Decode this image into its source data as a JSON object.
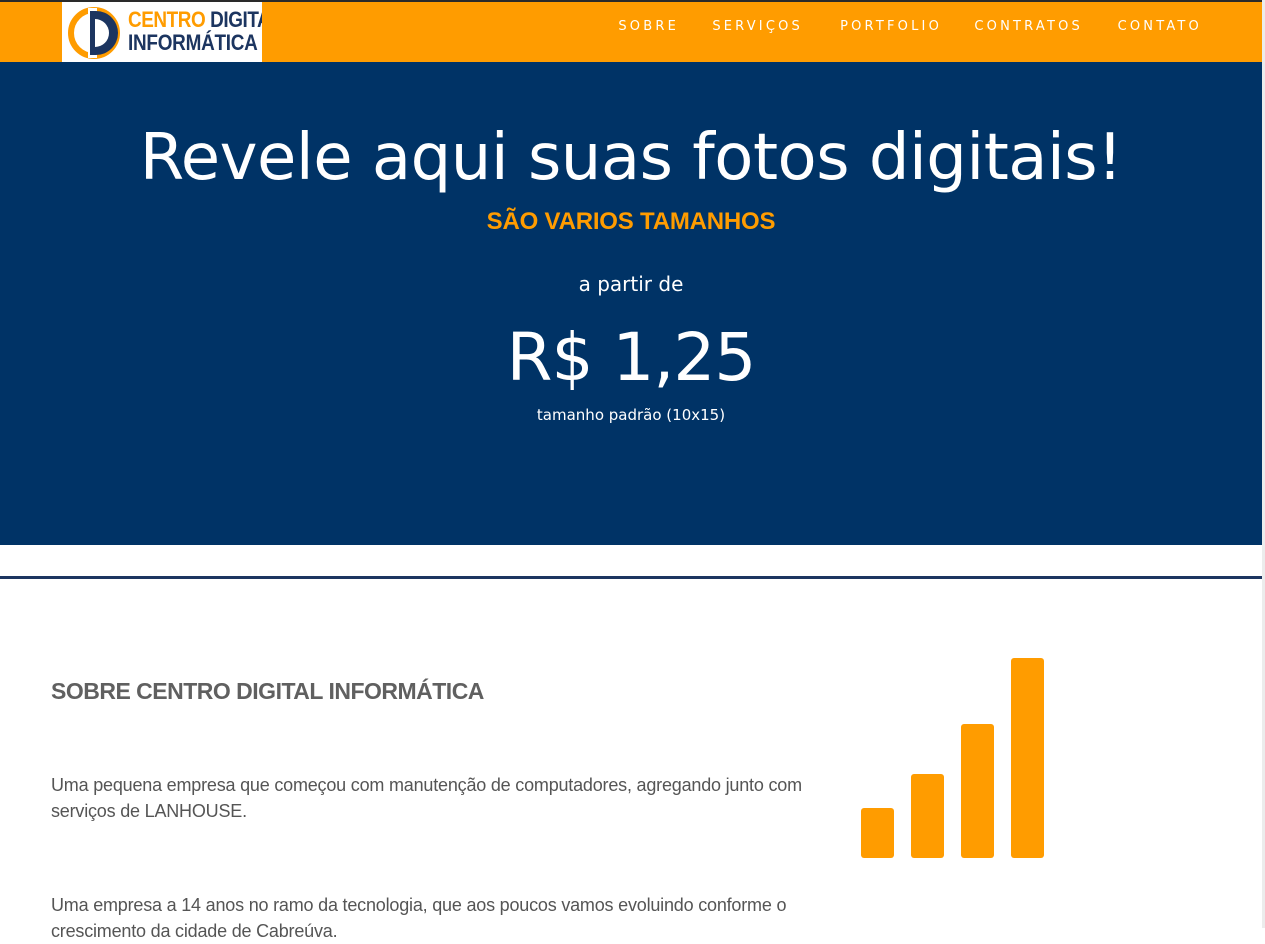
{
  "header": {
    "logo": {
      "word1": "CENTRO",
      "word2": "DIGITAL",
      "line2": "INFORMÁTICA",
      "icon": "cd-logo-icon",
      "colors": {
        "orange": "#ff9c00",
        "navy": "#1c3560"
      }
    },
    "nav": [
      {
        "label": "SOBRE"
      },
      {
        "label": "SERVIÇOS"
      },
      {
        "label": "PORTFOLIO"
      },
      {
        "label": "CONTRATOS"
      },
      {
        "label": "CONTATO"
      }
    ],
    "background": "#ff9c00"
  },
  "hero": {
    "title": "Revele aqui suas fotos digitais!",
    "subtitle": "SÃO VARIOS TAMANHOS",
    "from_label": "a partir de",
    "price": "R$ 1,25",
    "size_note": "tamanho padrão (10x15)",
    "background": "#003366",
    "accent": "#ff9c00"
  },
  "about": {
    "heading": "SOBRE CENTRO DIGITAL INFORMÁTICA",
    "paragraphs": [
      "Uma pequena empresa que começou com manutenção de computadores, agregando junto com serviços de LANHOUSE.",
      "Uma empresa a 14 anos no ramo da tecnologia, que aos poucos vamos evoluindo conforme o crescimento da cidade de Cabreúva."
    ],
    "graphic": {
      "icon": "growth-bars-icon",
      "color": "#ff9c00",
      "bar_levels": [
        0.25,
        0.42,
        0.67,
        1.0
      ]
    }
  }
}
